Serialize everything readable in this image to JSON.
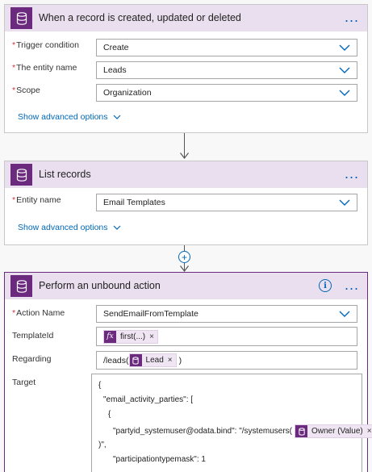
{
  "trigger": {
    "title": "When a record is created, updated or deleted",
    "more": "...",
    "fields": [
      {
        "label": "Trigger condition",
        "value": "Create"
      },
      {
        "label": "The entity name",
        "value": "Leads"
      },
      {
        "label": "Scope",
        "value": "Organization"
      }
    ],
    "advanced": "Show advanced options"
  },
  "list": {
    "title": "List records",
    "more": "...",
    "fields": [
      {
        "label": "Entity name",
        "value": "Email Templates"
      }
    ],
    "advanced": "Show advanced options"
  },
  "insert_symbol": "+",
  "action": {
    "title": "Perform an unbound action",
    "info": "i",
    "more": "...",
    "action_name_label": "Action Name",
    "action_name_value": "SendEmailFromTemplate",
    "templateid_label": "TemplateId",
    "templateid_token": "first(...)",
    "regarding_label": "Regarding",
    "regarding_prefix": "/leads(",
    "regarding_token": "Lead",
    "regarding_suffix": ")",
    "target_label": "Target",
    "target_lines": [
      "{",
      "\"email_activity_parties\": [",
      "{",
      "\"partyid_systemuser@odata.bind\": \"/systemusers(",
      ")\",",
      "\"participationtypemask\": 1"
    ],
    "target_token": "Owner (Value)",
    "token_close": "×",
    "fx_symbol": "fx"
  },
  "required_mark": "*",
  "colors": {
    "accent": "#6c2a7f",
    "header_bg": "#eadfee",
    "link": "#0067b8",
    "required": "#d13438"
  },
  "icons": [
    "database-icon",
    "chevron-down-icon",
    "more-icon",
    "info-icon",
    "add-icon",
    "fx-icon",
    "close-icon"
  ]
}
